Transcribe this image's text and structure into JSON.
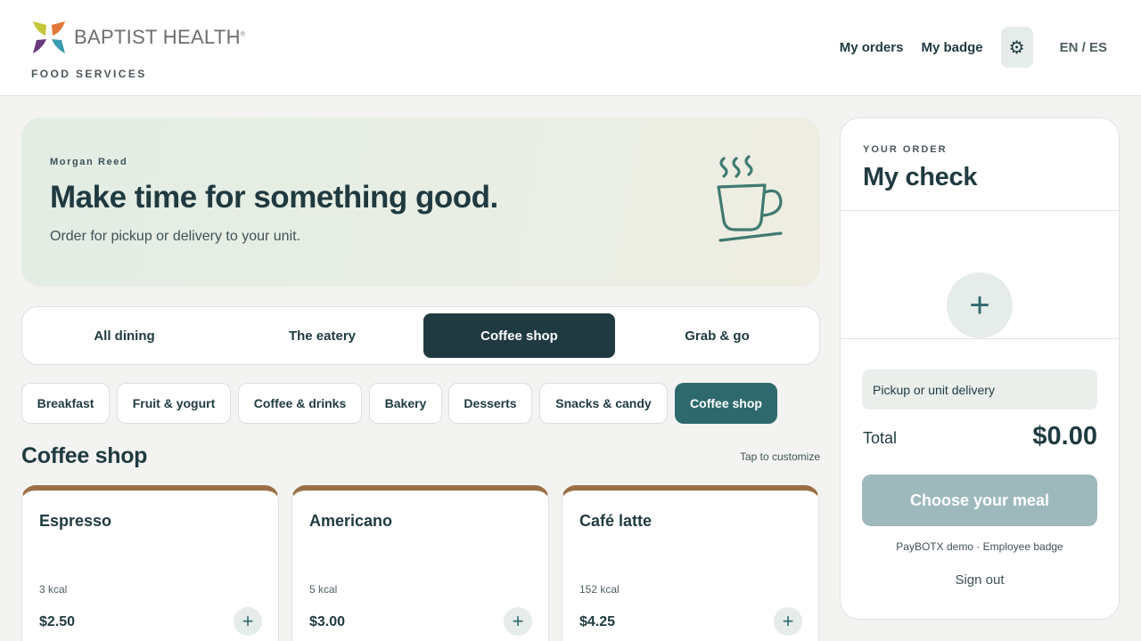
{
  "brand": {
    "name": "BAPTIST HEALTH",
    "registered": "®",
    "subtitle": "FOOD SERVICES",
    "logo_colors": [
      "#c3c63a",
      "#e0793a",
      "#6b3a7d",
      "#3b9ab0"
    ]
  },
  "nav": {
    "orders": "My orders",
    "badge": "My badge",
    "settings_icon": "gear-icon",
    "settings_glyph": "⚙",
    "language": "EN / ES"
  },
  "hero": {
    "user": "Morgan Reed",
    "title": "Make time for something good.",
    "subtitle": "Order for pickup or delivery to your unit.",
    "icon": "coffee-cup-icon"
  },
  "tabs": [
    {
      "label": "All dining",
      "active": false
    },
    {
      "label": "The eatery",
      "active": false
    },
    {
      "label": "Coffee shop",
      "active": true
    },
    {
      "label": "Grab & go",
      "active": false
    }
  ],
  "categories": [
    {
      "label": "Breakfast",
      "active": false
    },
    {
      "label": "Fruit & yogurt",
      "active": false
    },
    {
      "label": "Coffee & drinks",
      "active": false
    },
    {
      "label": "Bakery",
      "active": false
    },
    {
      "label": "Desserts",
      "active": false
    },
    {
      "label": "Snacks & candy",
      "active": false
    },
    {
      "label": "Coffee shop",
      "active": true
    }
  ],
  "section": {
    "title": "Coffee shop",
    "hint": "Tap to customize"
  },
  "items": [
    {
      "name": "Espresso",
      "kcal": "3 kcal",
      "price": "$2.50",
      "add": "+"
    },
    {
      "name": "Americano",
      "kcal": "5 kcal",
      "price": "$3.00",
      "add": "+"
    },
    {
      "name": "Café latte",
      "kcal": "152 kcal",
      "price": "$4.25",
      "add": "+"
    }
  ],
  "check": {
    "eyebrow": "YOUR ORDER",
    "title": "My check",
    "add": "+",
    "delivery": "Pickup or unit delivery",
    "total_label": "Total",
    "total_value": "$0.00",
    "choose": "Choose your meal",
    "payment_note": "PayBOTX demo · Employee badge",
    "signout": "Sign out"
  },
  "colors": {
    "primary_dark": "#203a42",
    "accent_teal": "#2e6a6d",
    "card_top": "#9a6f45",
    "button_disabled": "#9db9bb"
  }
}
